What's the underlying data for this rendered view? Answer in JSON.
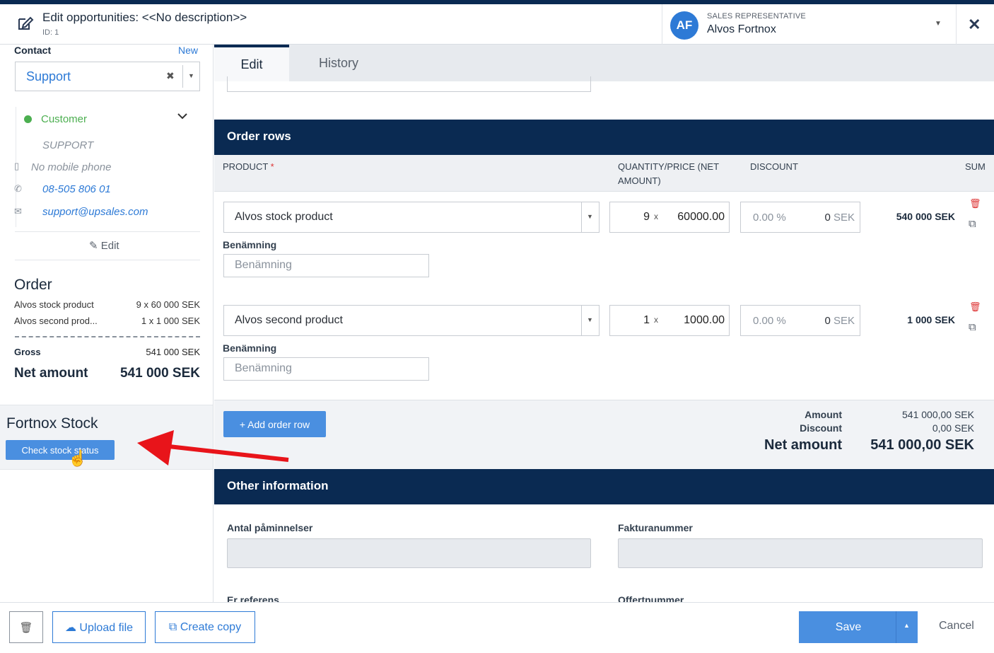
{
  "header": {
    "title": "Edit opportunities: <<No description>>",
    "id_text": "ID: 1",
    "avatar_initials": "AF",
    "rep_label": "SALES REPRESENTATIVE",
    "rep_name": "Alvos Fortnox",
    "close": "✕"
  },
  "contact": {
    "label": "Contact",
    "new_link": "New",
    "selected": "Support",
    "status": "Customer",
    "title": "SUPPORT",
    "mobile": "No mobile phone",
    "phone": "08-505 806 01",
    "email": "support@upsales.com",
    "edit": "Edit"
  },
  "order": {
    "title": "Order",
    "lines": [
      {
        "name": "Alvos stock product",
        "value": "9 x 60 000 SEK"
      },
      {
        "name": "Alvos second prod...",
        "value": "1 x 1 000 SEK"
      }
    ],
    "gross_label": "Gross",
    "gross_value": "541 000 SEK",
    "net_label": "Net amount",
    "net_value": "541 000 SEK"
  },
  "fortnox": {
    "title": "Fortnox Stock",
    "button": "Check stock status"
  },
  "tabs": [
    "Edit",
    "History"
  ],
  "order_rows": {
    "title": "Order rows",
    "columns": {
      "product": "PRODUCT",
      "qty": "QUANTITY/PRICE (NET AMOUNT)",
      "discount": "DISCOUNT",
      "sum": "SUM"
    },
    "rows": [
      {
        "product": "Alvos stock product",
        "qty": "9",
        "price": "60000.00",
        "discount_pct": "0.00",
        "discount_sek": "0",
        "sum": "540 000 SEK",
        "benamning_label": "Benämning",
        "benamning_placeholder": "Benämning"
      },
      {
        "product": "Alvos second product",
        "qty": "1",
        "price": "1000.00",
        "discount_pct": "0.00",
        "discount_sek": "0",
        "sum": "1 000 SEK",
        "benamning_label": "Benämning",
        "benamning_placeholder": "Benämning"
      }
    ],
    "x_symbol": "x",
    "pct_symbol": "%",
    "currency": "SEK",
    "add_button": "+ Add order row",
    "totals": {
      "amount_label": "Amount",
      "amount_value": "541 000,00 SEK",
      "discount_label": "Discount",
      "discount_value": "0,00 SEK",
      "net_label": "Net amount",
      "net_value": "541 000,00 SEK"
    }
  },
  "other_info": {
    "title": "Other information",
    "fields": [
      {
        "label": "Antal påminnelser",
        "value": ""
      },
      {
        "label": "Fakturanummer",
        "value": ""
      },
      {
        "label": "Er referens",
        "value": ""
      },
      {
        "label": "Offertnummer",
        "value": ""
      }
    ]
  },
  "footer": {
    "upload": "Upload file",
    "copy": "Create copy",
    "save": "Save",
    "cancel": "Cancel"
  },
  "colors": {
    "navy": "#0a2a52",
    "accent": "#2d7ad6",
    "button": "#4a8fe0",
    "success": "#4caf50",
    "danger": "#d33",
    "annotation_arrow": "#e8141a"
  }
}
